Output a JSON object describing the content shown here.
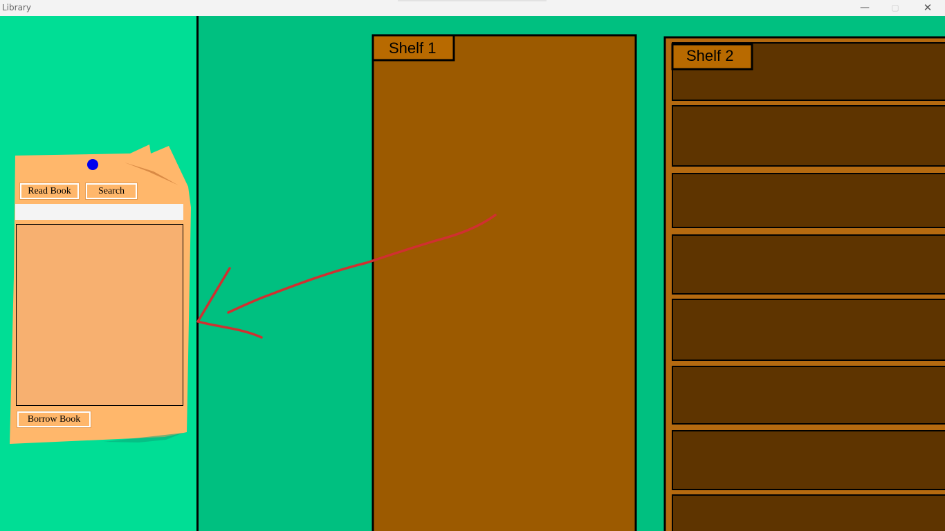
{
  "window": {
    "title": "Library",
    "controls": {
      "minimize": "—",
      "maximize": "▢",
      "close": "✕"
    }
  },
  "note": {
    "read_book_label": "Read Book",
    "search_label": "Search",
    "search_value": "",
    "borrow_label": "Borrow Book",
    "pin_color": "#0000ee"
  },
  "shelves": [
    {
      "label": "Shelf 1",
      "color": "#9c5a00"
    },
    {
      "label": "Shelf 2",
      "color": "#5e3400",
      "rail_color": "#b56a10"
    }
  ],
  "colors": {
    "left_panel": "#00de95",
    "background": "#00c080",
    "note": "#ffb76b",
    "arrow": "#d03030"
  }
}
